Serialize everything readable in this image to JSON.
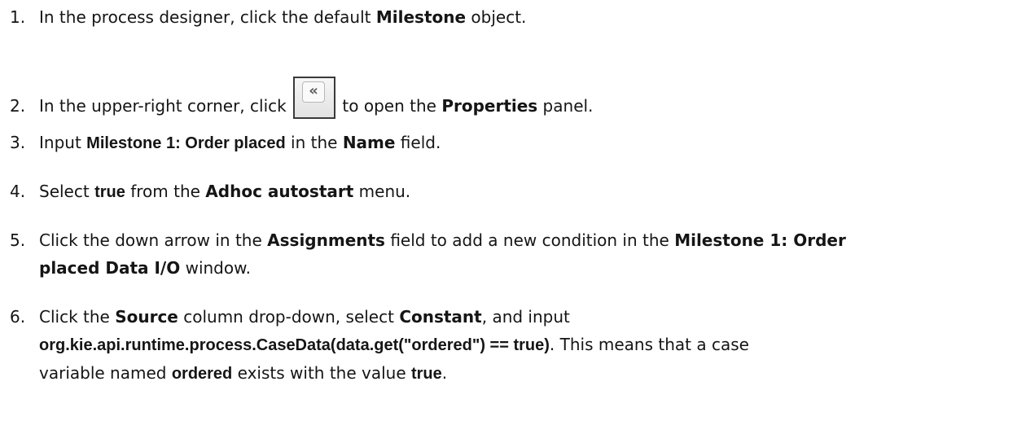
{
  "steps": [
    {
      "num": "1.",
      "t1": "In the process designer, click the default ",
      "b1": "Milestone",
      "t2": " object."
    },
    {
      "num": "2.",
      "t1": "In the upper-right corner, click ",
      "icon": "collapse-double-left-icon",
      "icon_glyph": "«",
      "t2": " to open the ",
      "b1": "Properties",
      "t3": " panel."
    },
    {
      "num": "3.",
      "t1": "Input ",
      "code1": "Milestone 1: Order placed",
      "t2": " in the ",
      "b1": "Name",
      "t3": " field."
    },
    {
      "num": "4.",
      "t1": "Select ",
      "code1": "true",
      "t2": " from the ",
      "b1": "Adhoc autostart",
      "t3": " menu."
    },
    {
      "num": "5.",
      "t1": "Click the down arrow in the ",
      "b1": "Assignments",
      "t2": " field to add a new condition in the ",
      "b2": "Milestone 1: Order",
      "b3": "placed Data I/O",
      "t3": " window."
    },
    {
      "num": "6.",
      "t1": "Click the ",
      "b1": "Source",
      "t2": " column drop-down, select ",
      "b2": "Constant",
      "t3": ", and input",
      "code1": "org.kie.api.runtime.process.CaseData(data.get(\"ordered\") == true)",
      "t4": ". This means that a case",
      "t5": "variable named ",
      "code2": "ordered",
      "t6": " exists with the value ",
      "code3": "true",
      "t7": "."
    }
  ]
}
